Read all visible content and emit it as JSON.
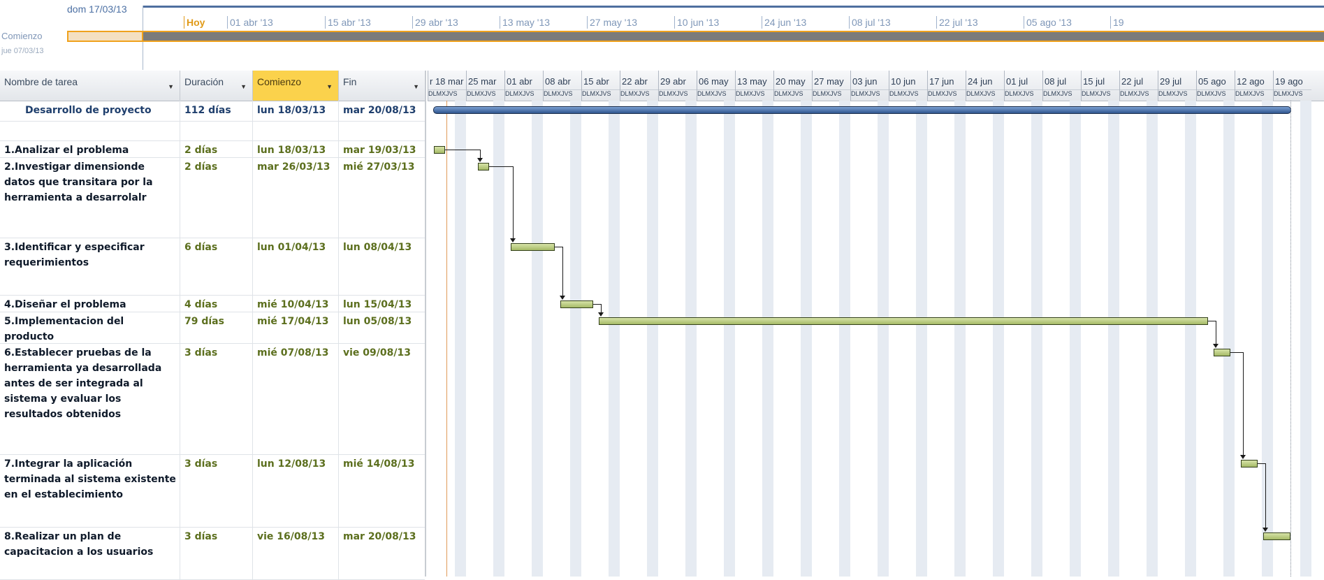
{
  "timeline": {
    "start_date_label": "dom 17/03/13",
    "comienzo_label": "Comienzo",
    "comienzo_date": "jue 07/03/13",
    "today_label": "Hoy",
    "marks": [
      "01 abr '13",
      "15 abr '13",
      "29 abr '13",
      "13 may '13",
      "27 may '13",
      "10 jun '13",
      "24 jun '13",
      "08 jul '13",
      "22 jul '13",
      "05 ago '13",
      "19"
    ],
    "colors": {
      "accent": "#f0a21d",
      "header_line": "#4f6f9f"
    }
  },
  "table": {
    "columns": {
      "name": "Nombre de tarea",
      "duration": "Duración",
      "start": "Comienzo",
      "end": "Fin"
    },
    "rows": [
      {
        "name": "Desarrollo de proyecto",
        "duration": "112 días",
        "start": "lun 18/03/13",
        "end": "mar 20/08/13",
        "summary": true
      },
      {
        "name": "",
        "duration": "",
        "start": "",
        "end": ""
      },
      {
        "name": "1.Analizar el problema",
        "duration": "2 días",
        "start": "lun 18/03/13",
        "end": "mar 19/03/13"
      },
      {
        "name": "2.Investigar dimensionde datos que transitara por la herramienta a desarrolalr",
        "duration": "2 días",
        "start": "mar 26/03/13",
        "end": "mié 27/03/13"
      },
      {
        "name": "3.Identificar y especificar requerimientos",
        "duration": "6 días",
        "start": "lun 01/04/13",
        "end": "lun 08/04/13"
      },
      {
        "name": "4.Diseñar el problema",
        "duration": "4 días",
        "start": "mié 10/04/13",
        "end": "lun 15/04/13"
      },
      {
        "name": "5.Implementacion del producto",
        "duration": "79 días",
        "start": "mié 17/04/13",
        "end": "lun 05/08/13"
      },
      {
        "name": "6.Establecer pruebas de la herramienta ya desarrollada antes de ser integrada al sistema y evaluar los resultados obtenidos",
        "duration": "3 días",
        "start": "mié 07/08/13",
        "end": "vie 09/08/13"
      },
      {
        "name": "7.Integrar la aplicación terminada al sistema existente en el establecimiento",
        "duration": "3 días",
        "start": "lun 12/08/13",
        "end": "mié 14/08/13"
      },
      {
        "name": "8.Realizar un plan de capacitacion a los usuarios",
        "duration": "3 días",
        "start": "vie 16/08/13",
        "end": "mar 20/08/13"
      }
    ]
  },
  "gantt": {
    "weeks": [
      "r 18 mar",
      "25 mar",
      "01 abr",
      "08 abr",
      "15 abr",
      "22 abr",
      "29 abr",
      "06 may",
      "13 may",
      "20 may",
      "27 may",
      "03 jun",
      "10 jun",
      "17 jun",
      "24 jun",
      "01 jul",
      "08 jul",
      "15 jul",
      "22 jul",
      "29 jul",
      "05 ago",
      "12 ago",
      "19 ago"
    ],
    "day_letters": "DLMXJVS",
    "colors": {
      "task_bar": "#a6bb67",
      "summary_bar": "#30568f",
      "nonworking": "#e6ebf2",
      "today_line": "#e09a5a"
    }
  }
}
